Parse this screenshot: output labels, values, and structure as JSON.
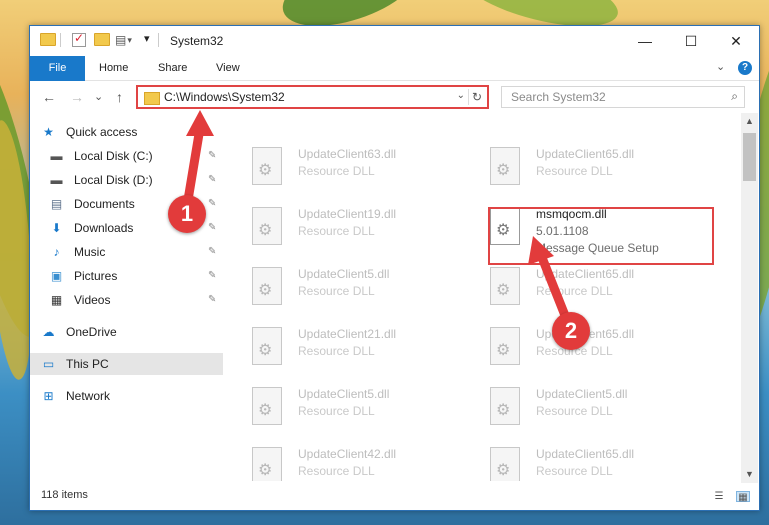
{
  "window": {
    "title": "System32"
  },
  "titlebar": {
    "minimize": "—",
    "maximize": "☐",
    "close": "✕",
    "customize_glyph": "▾"
  },
  "ribbon": {
    "tabs": [
      "File",
      "Home",
      "Share",
      "View"
    ],
    "expand_glyph": "⌄",
    "help_glyph": "?"
  },
  "nav": {
    "back": "←",
    "forward": "→",
    "recent": "⌄",
    "up": "↑",
    "address": "C:\\Windows\\System32",
    "address_dropdown": "⌄",
    "refresh": "↻",
    "search_placeholder": "Search System32",
    "search_glyph": "⌕"
  },
  "sidebar": {
    "items": [
      {
        "label": "Quick access",
        "icon": "star-icon",
        "glyph": "★",
        "color": "#1979ca",
        "pinned": false
      },
      {
        "label": "Local Disk (C:)",
        "icon": "drive-icon",
        "glyph": "▬",
        "color": "#555555",
        "pinned": true
      },
      {
        "label": "Local Disk (D:)",
        "icon": "drive-icon",
        "glyph": "▬",
        "color": "#555555",
        "pinned": true
      },
      {
        "label": "Documents",
        "icon": "documents-icon",
        "glyph": "▤",
        "color": "#5b6f8a",
        "pinned": true
      },
      {
        "label": "Downloads",
        "icon": "download-icon",
        "glyph": "⬇",
        "color": "#1979ca",
        "pinned": true
      },
      {
        "label": "Music",
        "icon": "music-icon",
        "glyph": "♪",
        "color": "#1979ca",
        "pinned": true
      },
      {
        "label": "Pictures",
        "icon": "pictures-icon",
        "glyph": "▣",
        "color": "#3a8fd0",
        "pinned": true
      },
      {
        "label": "Videos",
        "icon": "videos-icon",
        "glyph": "▦",
        "color": "#333333",
        "pinned": true
      },
      {
        "label": "OneDrive",
        "icon": "cloud-icon",
        "glyph": "☁",
        "color": "#1979ca",
        "pinned": false
      },
      {
        "label": "This PC",
        "icon": "computer-icon",
        "glyph": "▭",
        "color": "#1979ca",
        "pinned": false
      },
      {
        "label": "Network",
        "icon": "network-icon",
        "glyph": "⊞",
        "color": "#1979ca",
        "pinned": false
      }
    ],
    "pin_glyph": "📌"
  },
  "files": [
    {
      "name": "UpdateClient63.dll",
      "type": "Resource DLL"
    },
    {
      "name": "UpdateClient65.dll",
      "type": "Resource DLL"
    },
    {
      "name": "UpdateClient19.dll",
      "type": "Resource DLL"
    },
    {
      "name": "msmqocm.dll",
      "version": "5.01.1108",
      "type": "Message Queue Setup",
      "highlighted": true
    },
    {
      "name": "UpdateClient5.dll",
      "type": "Resource DLL"
    },
    {
      "name": "UpdateClient65.dll",
      "type": "Resource DLL"
    },
    {
      "name": "UpdateClient21.dll",
      "type": "Resource DLL"
    },
    {
      "name": "UpdateClient65.dll",
      "type": "Resource DLL"
    },
    {
      "name": "UpdateClient5.dll",
      "type": "Resource DLL"
    },
    {
      "name": "UpdateClient5.dll",
      "type": "Resource DLL"
    },
    {
      "name": "UpdateClient42.dll",
      "type": "Resource DLL"
    },
    {
      "name": "UpdateClient65.dll",
      "type": "Resource DLL"
    }
  ],
  "status": {
    "item_count": "118 items"
  },
  "annotations": {
    "badge1": "1",
    "badge2": "2",
    "color": "#e23b3b"
  },
  "colors": {
    "accent": "#1979ca",
    "highlight_border": "#e04444"
  }
}
